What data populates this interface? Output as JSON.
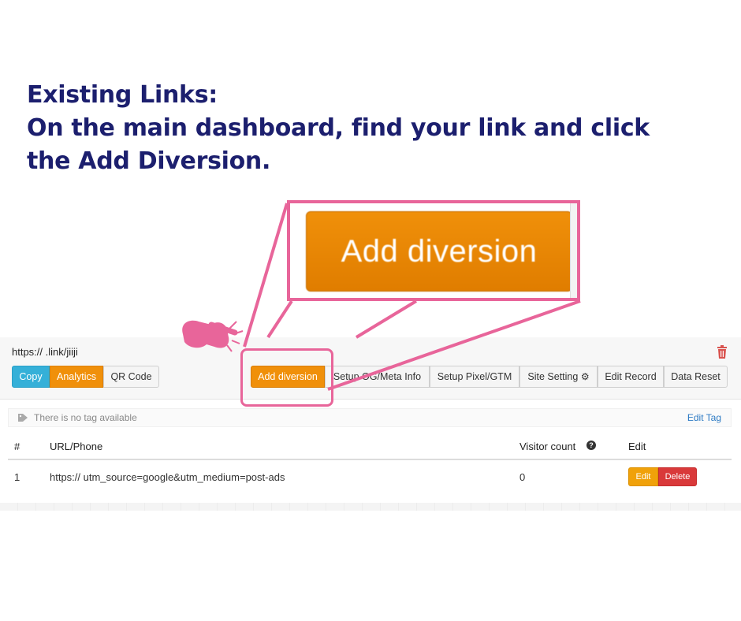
{
  "headline": {
    "line1": "Existing Links:",
    "line2": "On the main dashboard, find your link and click",
    "line3": "the Add Diversion."
  },
  "zoom": {
    "button_label": "Add diversion"
  },
  "link": {
    "url": "https://              .link/jiiji            "
  },
  "toolbar": {
    "copy_label": "Copy",
    "analytics_label": "Analytics",
    "qr_label": "QR Code",
    "add_diversion_label": "Add diversion",
    "og_label": "Setup OG/Meta Info",
    "pixel_label": "Setup Pixel/GTM",
    "site_label": "Site Setting",
    "record_label": "Edit Record",
    "reset_label": "Data Reset"
  },
  "tags": {
    "empty_text": "There is no tag available",
    "edit_label": "Edit Tag"
  },
  "table": {
    "headers": [
      "#",
      "URL/Phone",
      "Visitor count",
      "Edit"
    ],
    "rows": [
      {
        "index": "1",
        "url": "https://                        utm_source=google&utm_medium=post-ads",
        "visitors": "0",
        "edit_label": "Edit",
        "delete_label": "Delete"
      }
    ]
  },
  "colors": {
    "headline": "#1c1f6e",
    "callout": "#e8659a",
    "orange": "#f0900a",
    "blue": "#35b0d8",
    "red": "#d9393a"
  }
}
